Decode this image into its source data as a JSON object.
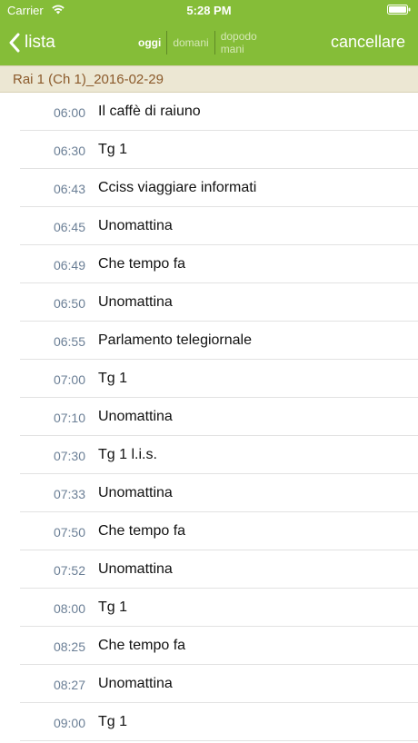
{
  "status_bar": {
    "carrier": "Carrier",
    "time": "5:28 PM"
  },
  "nav": {
    "back_label": "lista",
    "segments": [
      "oggi",
      "domani",
      "dopodomani"
    ],
    "segment_selected": "oggi",
    "cancel_label": "cancellare"
  },
  "section": {
    "title": "Rai 1 (Ch 1)_2016-02-29"
  },
  "programs": [
    {
      "time": "06:00",
      "title": "Il caffè di raiuno"
    },
    {
      "time": "06:30",
      "title": "Tg 1"
    },
    {
      "time": "06:43",
      "title": "Cciss viaggiare informati"
    },
    {
      "time": "06:45",
      "title": "Unomattina"
    },
    {
      "time": "06:49",
      "title": "Che tempo fa"
    },
    {
      "time": "06:50",
      "title": "Unomattina"
    },
    {
      "time": "06:55",
      "title": "Parlamento telegiornale"
    },
    {
      "time": "07:00",
      "title": "Tg 1"
    },
    {
      "time": "07:10",
      "title": "Unomattina"
    },
    {
      "time": "07:30",
      "title": "Tg 1 l.i.s."
    },
    {
      "time": "07:33",
      "title": "Unomattina"
    },
    {
      "time": "07:50",
      "title": "Che tempo fa"
    },
    {
      "time": "07:52",
      "title": "Unomattina"
    },
    {
      "time": "08:00",
      "title": "Tg 1"
    },
    {
      "time": "08:25",
      "title": "Che tempo fa"
    },
    {
      "time": "08:27",
      "title": "Unomattina"
    },
    {
      "time": "09:00",
      "title": "Tg 1"
    }
  ],
  "colors": {
    "nav_background": "#85bd38",
    "section_background": "#ece7d3",
    "section_text": "#8b5a2b",
    "time_text": "#6b7f96"
  },
  "icons": {
    "wifi": "wifi-icon",
    "battery": "battery-icon",
    "back": "chevron-left-icon"
  }
}
